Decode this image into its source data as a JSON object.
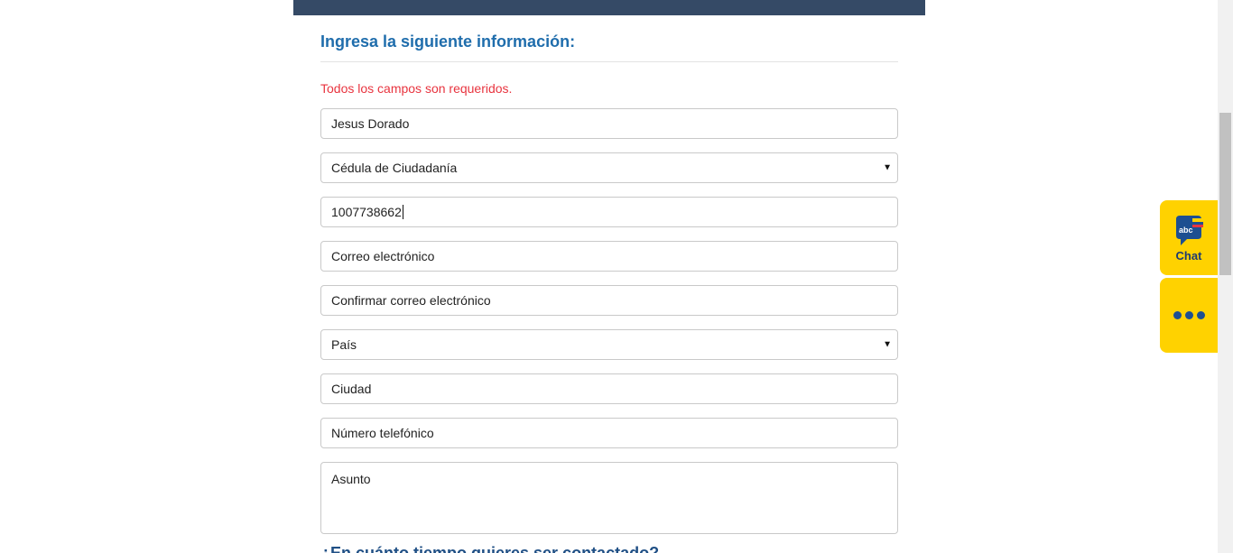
{
  "form": {
    "title": "Ingresa la siguiente información:",
    "required_note": "Todos los campos son requeridos.",
    "name_value": "Jesus Dorado",
    "doc_type_selected": "Cédula de Ciudadanía",
    "doc_number_value": "1007738662",
    "email_placeholder": "Correo electrónico",
    "email_confirm_placeholder": "Confirmar correo electrónico",
    "country_selected": "País",
    "city_placeholder": "Ciudad",
    "phone_placeholder": "Número telefónico",
    "subject_placeholder": "Asunto",
    "next_section_title": "¿En cuánto tiempo quieres ser contactado?"
  },
  "widgets": {
    "chat_label": "Chat",
    "chat_icon_text": "abc",
    "more_icon": "ellipsis-icon",
    "accent_color": "#ffd200",
    "brand_color": "#1d3b73"
  },
  "colors": {
    "header_bar": "#354a66",
    "title": "#1f6dac",
    "required": "#e8343f"
  }
}
